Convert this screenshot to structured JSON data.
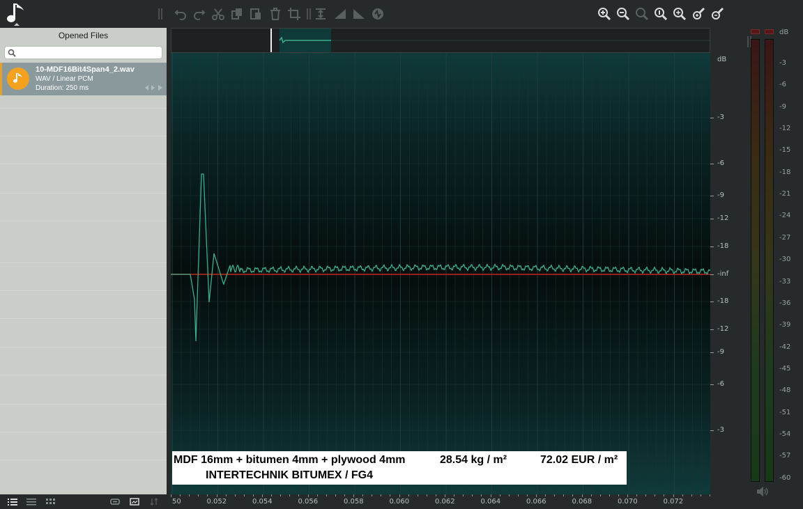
{
  "left_panel": {
    "title": "Opened Files",
    "search": {
      "placeholder": "",
      "value": ""
    },
    "file": {
      "name": "10-MDF16Bit4Span4_2.wav",
      "format": "WAV / Linear PCM",
      "duration": "Duration: 250 ms"
    }
  },
  "annotation": {
    "line1": "MDF 16mm + bitumen 4mm + plywood 4mm",
    "mass": "28.54 kg / m²",
    "price": "72.02 EUR / m²",
    "line2": "INTERTECHNIK BITUMEX / FG4"
  },
  "time_axis": {
    "labels": [
      "50",
      "0.052",
      "0.054",
      "0.056",
      "0.058",
      "0.060",
      "0.062",
      "0.064",
      "0.066",
      "0.068",
      "0.070",
      "0.072"
    ]
  },
  "db_axis": {
    "unit": "dB",
    "labels": [
      "-3",
      "-6",
      "-9",
      "-12",
      "-18",
      "-inf",
      "-18",
      "-12",
      "-9",
      "-6",
      "-3"
    ]
  },
  "meter": {
    "unit": "dB",
    "labels": [
      "-3",
      "-6",
      "-9",
      "-12",
      "-15",
      "-18",
      "-21",
      "-24",
      "-27",
      "-30",
      "-33",
      "-36",
      "-39",
      "-42",
      "-45",
      "-48",
      "-51",
      "-54",
      "-57",
      "-60"
    ]
  },
  "icons": {
    "toolbar": [
      "undo-icon",
      "redo-icon",
      "cut-icon",
      "copy-icon",
      "paste-icon",
      "delete-icon",
      "crop-icon",
      "normalize-icon",
      "fade-in-icon",
      "fade-out-icon",
      "effects-icon",
      "zoom-in-icon",
      "zoom-out-icon",
      "zoom-selection-icon",
      "zoom-fit-icon",
      "zoom-full-icon",
      "zoom-in-vertical-icon",
      "zoom-out-vertical-icon"
    ]
  },
  "colors": {
    "accent": "#f3a11f",
    "waveform": "#3fae8e",
    "zero_line": "#c0281e",
    "selected_row": "#8a9a9c"
  }
}
